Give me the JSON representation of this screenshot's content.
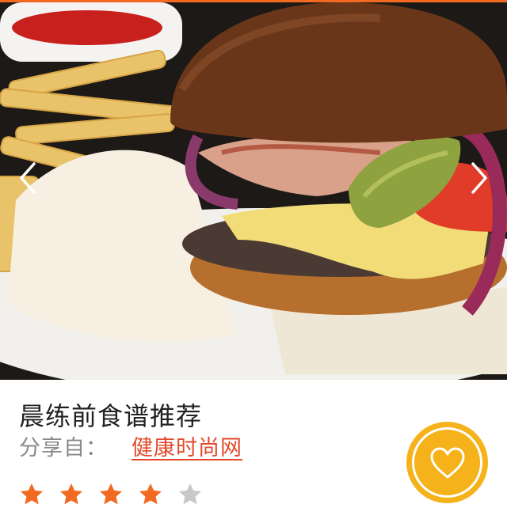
{
  "hero": {
    "image_description_icon": "burger-photo",
    "prev_icon": "chevron-left-icon",
    "next_icon": "chevron-right-icon"
  },
  "recipe": {
    "title": "晨练前食谱推荐",
    "shared_label": "分享自：",
    "shared_source": "健康时尚网"
  },
  "rating": {
    "value": 4,
    "max": 5,
    "filled_color": "#f26a22",
    "empty_color": "#c8c8c8"
  },
  "favorite": {
    "icon": "heart-icon",
    "color": "#f6b21a"
  },
  "accent_color": "#f26a22"
}
